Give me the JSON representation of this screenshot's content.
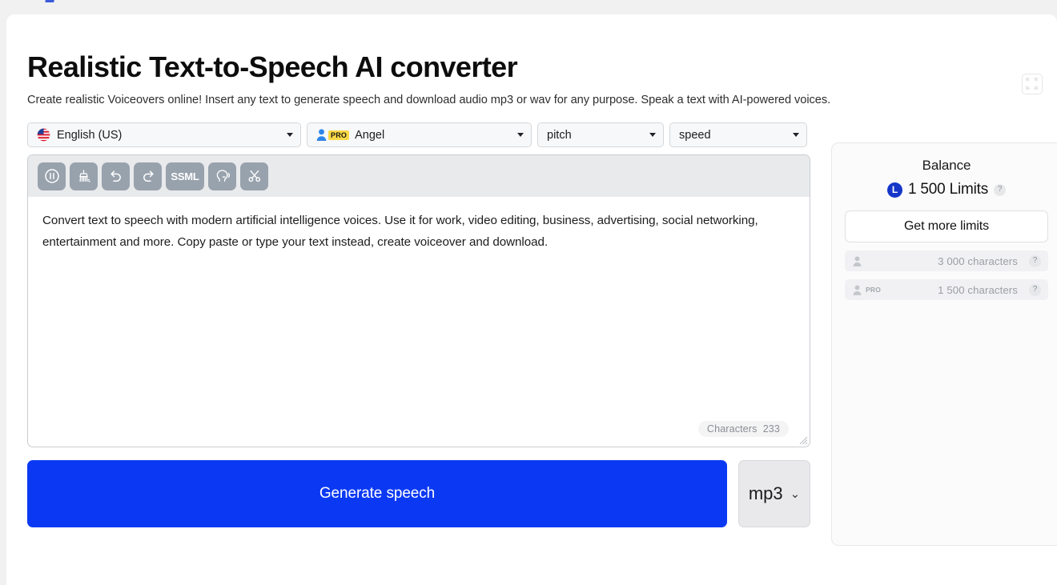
{
  "header": {
    "title": "Realistic Text-to-Speech AI converter",
    "subtitle": "Create realistic Voiceovers online! Insert any text to generate speech and download audio mp3 or wav for any purpose. Speak a text with AI-powered voices.",
    "fullscreen_icon": "fullscreen-expand-icon"
  },
  "controls": {
    "language": {
      "label": "English (US)",
      "icon": "us-flag-icon"
    },
    "voice": {
      "label": "Angel",
      "badge": "PRO",
      "icon": "person-icon"
    },
    "pitch": {
      "label": "pitch"
    },
    "speed": {
      "label": "speed"
    }
  },
  "toolbar": {
    "buttons": [
      {
        "name": "pause-button",
        "icon": "pause-circle-icon",
        "label": ""
      },
      {
        "name": "clear-text-button",
        "icon": "broom-icon",
        "label": ""
      },
      {
        "name": "undo-button",
        "icon": "undo-arrow-icon",
        "label": ""
      },
      {
        "name": "redo-button",
        "icon": "redo-arrow-icon",
        "label": ""
      },
      {
        "name": "ssml-button",
        "icon": "ssml-text-icon",
        "label": "SSML"
      },
      {
        "name": "speak-preview-button",
        "icon": "speaking-head-icon",
        "label": ""
      },
      {
        "name": "cut-button",
        "icon": "scissors-icon",
        "label": ""
      }
    ]
  },
  "editor": {
    "text": "Convert text to speech with modern artificial intelligence voices. Use it for work, video editing, business, advertising, social networking, entertainment and more. Copy paste or type your text instead, create voiceover and download.",
    "counter_label": "Characters",
    "counter_value": "233"
  },
  "actions": {
    "generate_label": "Generate speech",
    "format_label": "mp3",
    "format_caret": "⌄",
    "generate_color": "#0b39f3"
  },
  "balance": {
    "title": "Balance",
    "coin_letter": "L",
    "amount": "1 500 Limits",
    "help_icon": "?",
    "get_more_label": "Get more limits",
    "rows": [
      {
        "icon": "person-icon",
        "badge": "",
        "text": "3 000 characters",
        "help": "?"
      },
      {
        "icon": "person-icon",
        "badge": "PRO",
        "text": "1 500 characters",
        "help": "?"
      }
    ]
  }
}
